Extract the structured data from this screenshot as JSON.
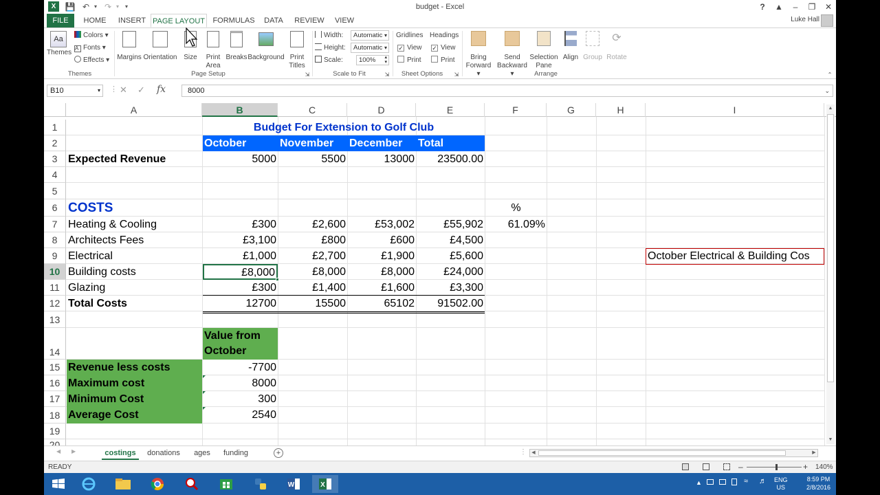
{
  "window": {
    "title": "budget - Excel",
    "user": "Luke Hall"
  },
  "tabs": [
    {
      "label": "FILE"
    },
    {
      "label": "HOME"
    },
    {
      "label": "INSERT"
    },
    {
      "label": "PAGE LAYOUT"
    },
    {
      "label": "FORMULAS"
    },
    {
      "label": "DATA"
    },
    {
      "label": "REVIEW"
    },
    {
      "label": "VIEW"
    }
  ],
  "ribbon": {
    "themes": {
      "themes_label": "Themes",
      "colors": "Colors",
      "fonts": "Fonts",
      "effects": "Effects",
      "group": "Themes"
    },
    "page_setup": {
      "margins": "Margins",
      "orientation": "Orientation",
      "size": "Size",
      "print_area_1": "Print",
      "print_area_2": "Area",
      "breaks": "Breaks",
      "background": "Background",
      "print_titles_1": "Print",
      "print_titles_2": "Titles",
      "group": "Page Setup"
    },
    "scale_to_fit": {
      "width_label": "Width:",
      "width_value": "Automatic",
      "height_label": "Height:",
      "height_value": "Automatic",
      "scale_label": "Scale:",
      "scale_value": "100%",
      "group": "Scale to Fit"
    },
    "sheet_options": {
      "gridlines": "Gridlines",
      "headings": "Headings",
      "view": "View",
      "print": "Print",
      "group": "Sheet Options"
    },
    "arrange": {
      "bring_1": "Bring",
      "bring_2": "Forward",
      "send_1": "Send",
      "send_2": "Backward",
      "selection_1": "Selection",
      "selection_2": "Pane",
      "align": "Align",
      "group_btn": "Group",
      "rotate": "Rotate",
      "group": "Arrange"
    }
  },
  "formula_bar": {
    "name_box": "B10",
    "fx": "fx",
    "formula": "8000"
  },
  "columns": [
    "A",
    "B",
    "C",
    "D",
    "E",
    "F",
    "G",
    "H",
    "I"
  ],
  "rows": [
    "1",
    "2",
    "3",
    "4",
    "5",
    "6",
    "7",
    "8",
    "9",
    "10",
    "11",
    "12",
    "13",
    "14",
    "15",
    "16",
    "17",
    "18",
    "19",
    "20"
  ],
  "cells": {
    "title": "Budget For Extension to Golf Club",
    "header": {
      "october": "October",
      "november": "November",
      "december": "December",
      "total": "Total"
    },
    "expected_revenue": {
      "label": "Expected Revenue",
      "b": "5000",
      "c": "5500",
      "d": "13000",
      "e": "23500.00"
    },
    "costs_heading": "COSTS",
    "percent_heading": "%",
    "costs": [
      {
        "label": "Heating & Cooling",
        "b": "£300",
        "c": "£2,600",
        "d": "£53,002",
        "e": "£55,902",
        "f": "61.09%"
      },
      {
        "label": "Architects Fees",
        "b": "£3,100",
        "c": "£800",
        "d": "£600",
        "e": "£4,500",
        "f": ""
      },
      {
        "label": "Electrical",
        "b": "£1,000",
        "c": "£2,700",
        "d": "£1,900",
        "e": "£5,600",
        "f": ""
      },
      {
        "label": "Building costs",
        "b": "£8,000",
        "c": "£8,000",
        "d": "£8,000",
        "e": "£24,000",
        "f": ""
      },
      {
        "label": "Glazing",
        "b": "£300",
        "c": "£1,400",
        "d": "£1,600",
        "e": "£3,300",
        "f": ""
      }
    ],
    "total_costs": {
      "label": "Total Costs",
      "b": "12700",
      "c": "15500",
      "d": "65102",
      "e": "91502.00"
    },
    "value_from_october_1": "Value from",
    "value_from_october_2": "October",
    "stats": [
      {
        "label": "Revenue less costs",
        "value": "-7700"
      },
      {
        "label": "Maximum cost",
        "value": "8000"
      },
      {
        "label": "Minimum Cost",
        "value": "300"
      },
      {
        "label": "Average Cost",
        "value": "2540"
      }
    ],
    "i9": "October Electrical & Building Cos"
  },
  "sheets": [
    "costings",
    "donations",
    "ages",
    "funding"
  ],
  "status": {
    "ready": "READY",
    "zoom": "140%"
  },
  "tray": {
    "lang_1": "ENG",
    "lang_2": "US",
    "time": "8:59 PM",
    "date": "2/8/2016"
  },
  "colors": {
    "excel_green": "#217346",
    "header_blue": "#0066ff",
    "title_blue": "#0033cc",
    "stats_green": "#5fae4f",
    "selection_outline": "#217346",
    "red_box": "#c00000",
    "taskbar": "#1d5fa7"
  }
}
